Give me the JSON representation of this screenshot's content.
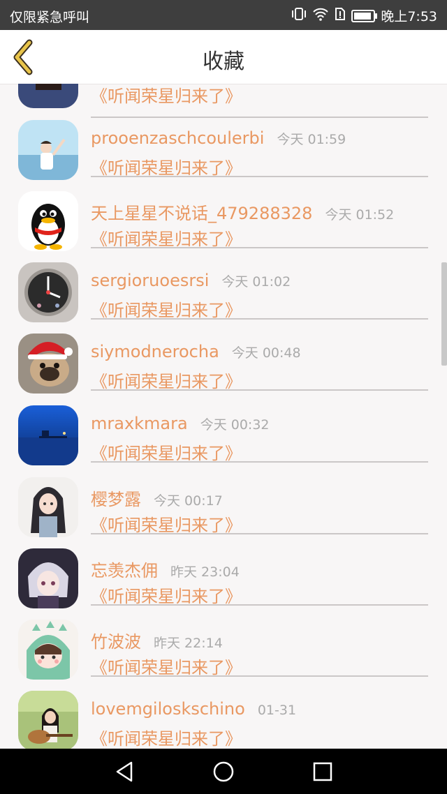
{
  "status": {
    "left_text": "仅限紧急呼叫",
    "time": "晚上7:53",
    "battery_level": 0.9
  },
  "header": {
    "title": "收藏"
  },
  "items": [
    {
      "name": "",
      "time": "",
      "song": "《听闻荣星归来了》",
      "avatar": "woman-photo"
    },
    {
      "name": "prooenzaschcoulerbi",
      "time": "今天 01:59",
      "song": "《听闻荣星归来了》",
      "avatar": "man-sea-photo"
    },
    {
      "name": "天上星星不说话_479288328",
      "time": "今天 01:52",
      "song": "《听闻荣星归来了》",
      "avatar": "qq-penguin"
    },
    {
      "name": "sergioruoesrsi",
      "time": "今天 01:02",
      "song": "《听闻荣星归来了》",
      "avatar": "clock"
    },
    {
      "name": "siymodnerocha",
      "time": "今天 00:48",
      "song": "《听闻荣星归来了》",
      "avatar": "pug-dog"
    },
    {
      "name": "mraxkmara",
      "time": "今天 00:32",
      "song": "《听闻荣星归来了》",
      "avatar": "pier-night"
    },
    {
      "name": "樱梦露",
      "time": "今天 00:17",
      "song": "《听闻荣星归来了》",
      "avatar": "anime-girl"
    },
    {
      "name": "忘羡杰佣",
      "time": "昨天 23:04",
      "song": "《听闻荣星归来了》",
      "avatar": "anime-boy"
    },
    {
      "name": "竹波波",
      "time": "昨天 22:14",
      "song": "《听闻荣星归来了》",
      "avatar": "dino-girl"
    },
    {
      "name": "lovemgiloskschino",
      "time": "01-31",
      "song": "《听闻荣星归来了》",
      "avatar": "guitar-girl"
    }
  ],
  "colors": {
    "accent": "#e99862",
    "back_arrow": "#e8c44a",
    "time": "#aaaaaa"
  }
}
